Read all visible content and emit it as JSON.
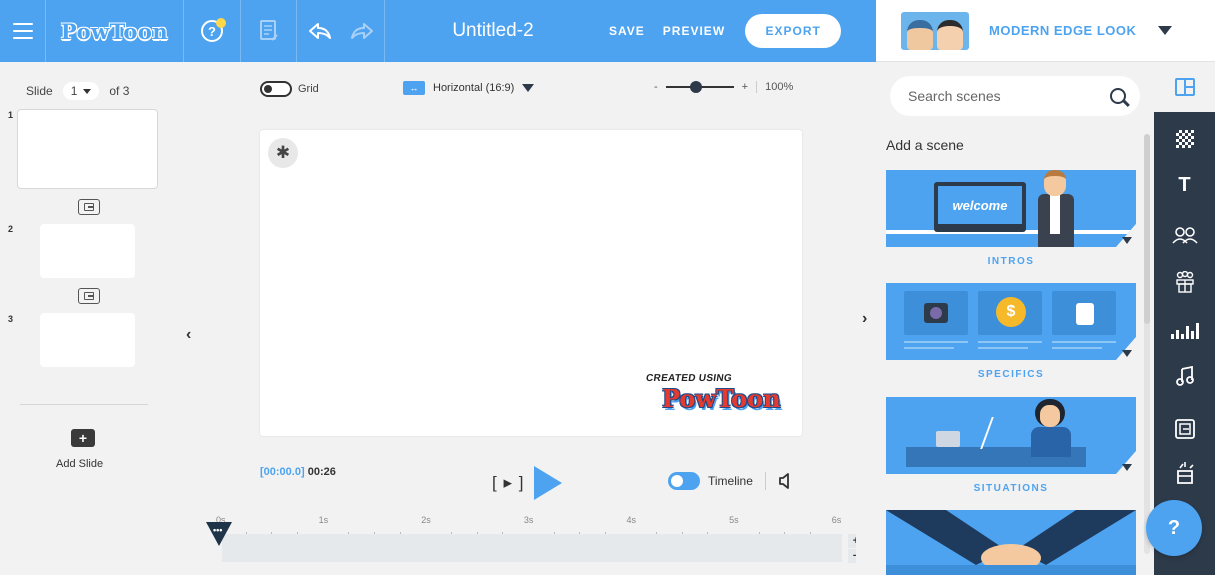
{
  "topbar": {
    "logo": "PowToon",
    "title": "Untitled-2",
    "save_label": "SAVE",
    "preview_label": "PREVIEW",
    "export_label": "EXPORT",
    "help_glyph": "?",
    "accent_color": "#4da3f0"
  },
  "look": {
    "name": "MODERN EDGE LOOK"
  },
  "slides": {
    "label": "Slide",
    "current": "1",
    "of_label": "of 3",
    "items": [
      {
        "number": "1"
      },
      {
        "number": "2"
      },
      {
        "number": "3"
      }
    ],
    "add_label": "Add Slide",
    "add_glyph": "+"
  },
  "canvas_toolbar": {
    "grid_label": "Grid",
    "orientation_label": "Horizontal (16:9)",
    "orientation_glyph": "↔",
    "zoom_minus": "-",
    "zoom_plus": "+",
    "zoom_value": "100%",
    "zoom_fraction": 0.45
  },
  "stage": {
    "settings_glyph": "✱",
    "watermark_top": "CREATED USING",
    "watermark_logo": "PowToon",
    "left_arrow": "‹",
    "right_arrow": "›"
  },
  "playback": {
    "current_time": "[00:00.0]",
    "total_time": "00:26",
    "step_glyph": "[ ▸ ]",
    "timeline_label": "Timeline",
    "speaker_glyph": "🔈"
  },
  "ruler": {
    "ticks": [
      "0s",
      "1s",
      "2s",
      "3s",
      "4s",
      "5s",
      "6s"
    ],
    "playhead_dots": "•••",
    "zoom_in": "+",
    "zoom_out": "−"
  },
  "library": {
    "search_placeholder": "Search scenes",
    "heading": "Add a scene",
    "scenes": [
      {
        "label": "INTROS",
        "art_text": "welcome"
      },
      {
        "label": "SPECIFICS",
        "art_text": "$"
      },
      {
        "label": "SITUATIONS"
      }
    ]
  },
  "tools": {
    "text_glyph": "T",
    "characters_glyph": "ᴙᴙ",
    "props_glyph": "♕",
    "music_glyph": "♫",
    "media_glyph": "⧉",
    "spotlight_glyph": "⌭"
  },
  "help_fab": {
    "glyph": "?"
  }
}
